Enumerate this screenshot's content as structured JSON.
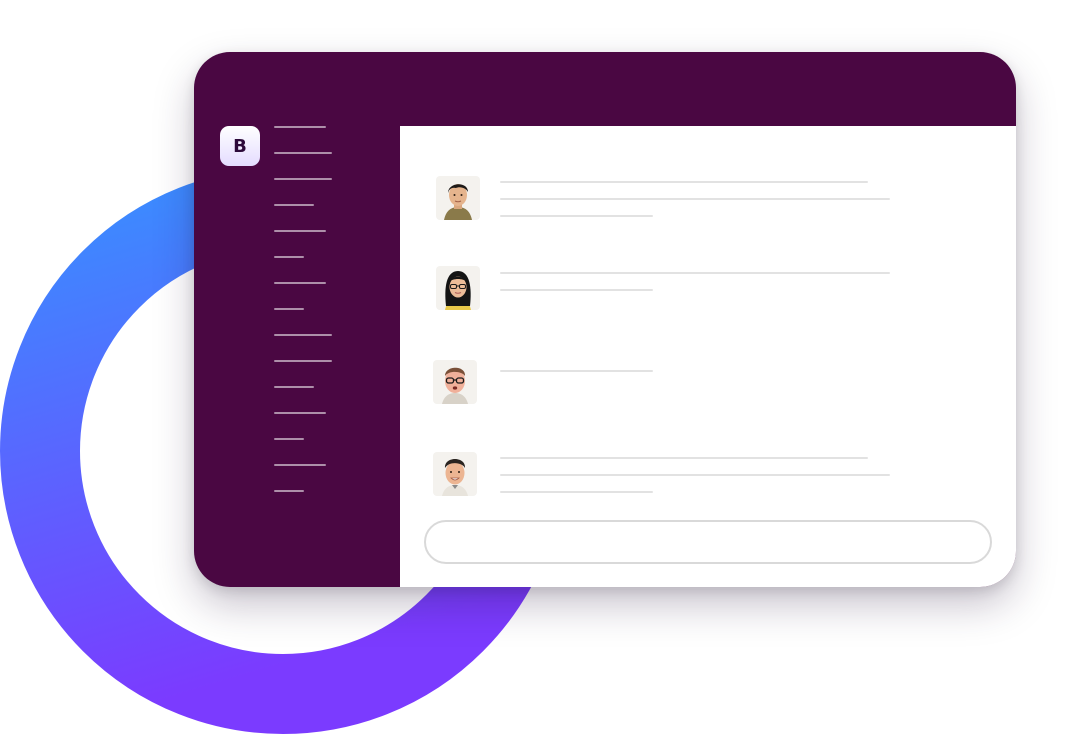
{
  "workspace": {
    "initial": "B"
  },
  "colors": {
    "sidebar_bg": "#4a0742",
    "content_bg": "#ffffff",
    "ring_gradient_start": "#3a8dff",
    "ring_gradient_end": "#7b3bff"
  },
  "sidebar": {
    "item_count": 15
  },
  "messages": [
    {
      "avatar": "man-dark-hair-avatar-icon"
    },
    {
      "avatar": "woman-glasses-avatar-icon"
    },
    {
      "avatar": "man-glasses-avatar-icon"
    },
    {
      "avatar": "man-smiling-avatar-icon"
    }
  ],
  "composer": {
    "value": "",
    "placeholder": ""
  }
}
